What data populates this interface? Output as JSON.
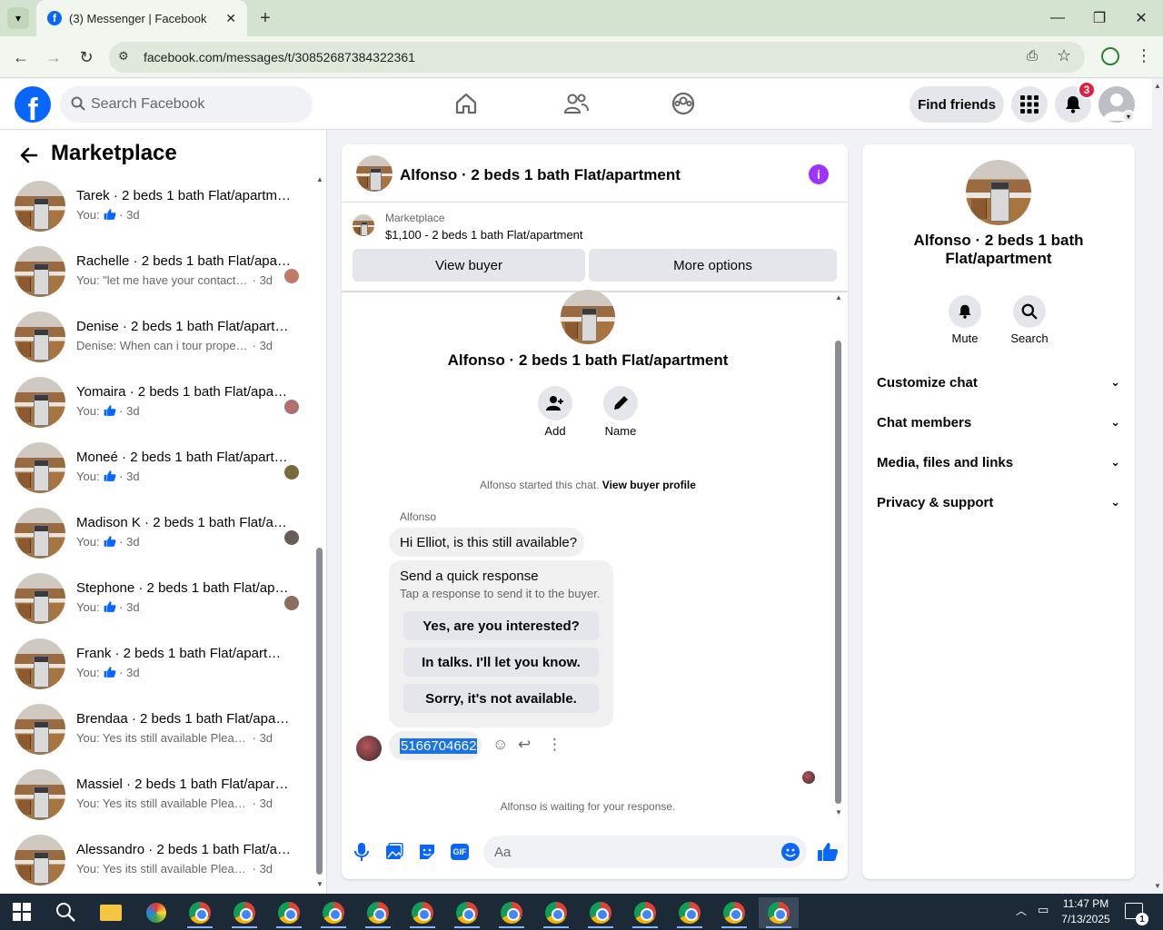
{
  "browser": {
    "tab_title": "(3) Messenger | Facebook",
    "url": "facebook.com/messages/t/30852687384322361"
  },
  "fb": {
    "search_placeholder": "Search Facebook",
    "find_friends": "Find friends",
    "notification_count": "3",
    "brand_color": "#0866ff"
  },
  "left": {
    "title": "Marketplace",
    "conversations": [
      {
        "name": "Tarek · 2 beds 1 bath Flat/apartment",
        "sub": "You:",
        "like": true,
        "time": "3d",
        "seen": false
      },
      {
        "name": "Rachelle · 2 beds 1 bath Flat/apartment",
        "sub": "You: \"let me have your contact n...",
        "like": false,
        "time": "3d",
        "seen": true
      },
      {
        "name": "Denise · 2 beds 1 bath Flat/apartment",
        "sub": "Denise: When can i tour property?",
        "like": false,
        "time": "3d",
        "seen": false
      },
      {
        "name": "Yomaira · 2 beds 1 bath Flat/apartment",
        "sub": "You:",
        "like": true,
        "time": "3d",
        "seen": true
      },
      {
        "name": "Moneé · 2 beds 1 bath Flat/apartment",
        "sub": "You:",
        "like": true,
        "time": "3d",
        "seen": true
      },
      {
        "name": "Madison K · 2 beds 1 bath Flat/apartment",
        "sub": "You:",
        "like": true,
        "time": "3d",
        "seen": true
      },
      {
        "name": "Stephone · 2 beds 1 bath Flat/apartment",
        "sub": "You:",
        "like": true,
        "time": "3d",
        "seen": true
      },
      {
        "name": "Frank · 2 beds 1 bath Flat/apartment",
        "sub": "You:",
        "like": true,
        "time": "3d",
        "seen": false
      },
      {
        "name": "Brendaa · 2 beds 1 bath Flat/apartment",
        "sub": "You: Yes its still available Please sen...",
        "like": false,
        "time": "3d",
        "seen": false
      },
      {
        "name": "Massiel · 2 beds 1 bath Flat/apartment",
        "sub": "You: Yes its still available Please sen...",
        "like": false,
        "time": "3d",
        "seen": false
      },
      {
        "name": "Alessandro · 2 beds 1 bath Flat/apartment",
        "sub": "You: Yes its still available Please sen...",
        "like": false,
        "time": "3d",
        "seen": false
      }
    ]
  },
  "chat": {
    "header_title": "Alfonso · 2 beds 1 bath Flat/apartment",
    "listing_label": "Marketplace",
    "listing_price": "$1,100 - 2 beds 1 bath Flat/apartment",
    "view_buyer": "View buyer",
    "more_options": "More options",
    "profile_name": "Alfonso · 2 beds 1 bath Flat/apartment",
    "add_label": "Add",
    "name_label": "Name",
    "started_text": "Alfonso started this chat.",
    "view_profile": "View buyer profile",
    "sender": "Alfonso",
    "message1": "Hi Elliot, is this still available?",
    "quick_title": "Send a quick response",
    "quick_sub": "Tap a response to send it to the buyer.",
    "quick_responses": [
      "Yes, are you interested?",
      "In talks. I'll let you know.",
      "Sorry, it's not available."
    ],
    "message2": "5166704662",
    "waiting": "Alfonso is waiting for your response.",
    "input_placeholder": "Aa"
  },
  "right": {
    "name": "Alfonso · 2 beds 1 bath Flat/apartment",
    "mute": "Mute",
    "search": "Search",
    "sections": [
      "Customize chat",
      "Chat members",
      "Media, files and links",
      "Privacy & support"
    ]
  },
  "taskbar": {
    "time": "11:47 PM",
    "date": "7/13/2025",
    "notif": "1"
  }
}
